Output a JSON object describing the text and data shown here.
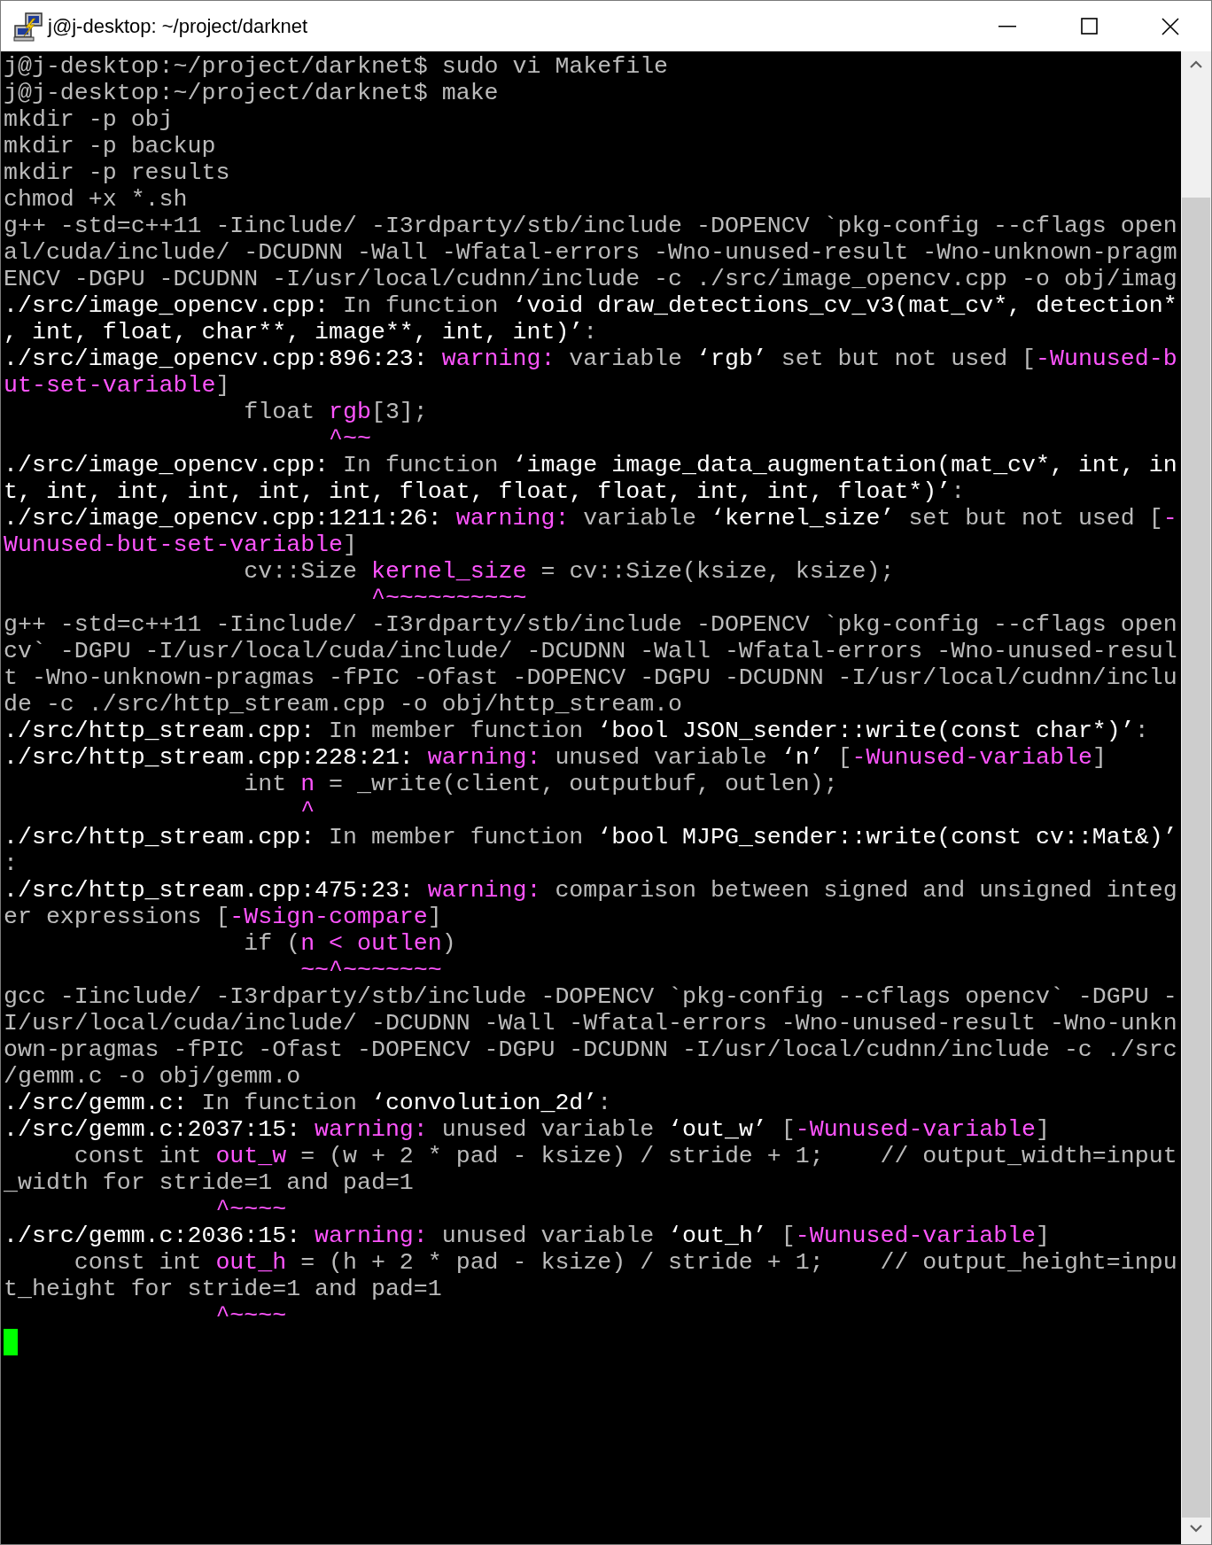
{
  "window": {
    "title": "j@j-desktop: ~/project/darknet"
  },
  "terminal": {
    "lines": [
      {
        "text": "j@j-desktop:~/project/darknet$ sudo vi Makefile"
      },
      {
        "text": "j@j-desktop:~/project/darknet$ make"
      },
      {
        "text": "mkdir -p obj"
      },
      {
        "text": "mkdir -p backup"
      },
      {
        "text": "mkdir -p results"
      },
      {
        "text": "chmod +x *.sh"
      },
      {
        "text": "g++ -std=c++11 -Iinclude/ -I3rdparty/stb/include -DOPENCV `pkg-config --cflags open"
      },
      {
        "text": "al/cuda/include/ -DCUDNN -Wall -Wfatal-errors -Wno-unused-result -Wno-unknown-pragm"
      },
      {
        "text": "ENCV -DGPU -DCUDNN -I/usr/local/cudnn/include -c ./src/image_opencv.cpp -o obj/imag"
      },
      {
        "spans": [
          {
            "text": "./src/image_opencv.cpp:",
            "kind": "bold"
          },
          {
            "text": " In function ",
            "kind": "normal"
          },
          {
            "text": "‘void draw_detections_cv_v3(mat_cv*, detection*",
            "kind": "bold"
          }
        ]
      },
      {
        "spans": [
          {
            "text": ", int, float, char**, image**, int, int)’",
            "kind": "bold"
          },
          {
            "text": ":",
            "kind": "normal"
          }
        ]
      },
      {
        "spans": [
          {
            "text": "./src/image_opencv.cpp:896:23: ",
            "kind": "bold"
          },
          {
            "text": "warning:",
            "kind": "accent"
          },
          {
            "text": " variable ",
            "kind": "normal"
          },
          {
            "text": "‘rgb’",
            "kind": "bold"
          },
          {
            "text": " set but not used [",
            "kind": "normal"
          },
          {
            "text": "-Wunused-b",
            "kind": "accent"
          }
        ]
      },
      {
        "spans": [
          {
            "text": "ut-set-variable",
            "kind": "accent"
          },
          {
            "text": "]",
            "kind": "normal"
          }
        ]
      },
      {
        "spans": [
          {
            "text": "                 float ",
            "kind": "normal"
          },
          {
            "text": "rgb",
            "kind": "accent"
          },
          {
            "text": "[3];",
            "kind": "normal"
          }
        ]
      },
      {
        "spans": [
          {
            "text": "                       ^~~",
            "kind": "accent"
          }
        ]
      },
      {
        "spans": [
          {
            "text": "./src/image_opencv.cpp:",
            "kind": "bold"
          },
          {
            "text": " In function ",
            "kind": "normal"
          },
          {
            "text": "‘image image_data_augmentation(mat_cv*, int, in",
            "kind": "bold"
          }
        ]
      },
      {
        "spans": [
          {
            "text": "t, int, int, int, int, int, float, float, float, int, int, float*)’",
            "kind": "bold"
          },
          {
            "text": ":",
            "kind": "normal"
          }
        ]
      },
      {
        "spans": [
          {
            "text": "./src/image_opencv.cpp:1211:26: ",
            "kind": "bold"
          },
          {
            "text": "warning:",
            "kind": "accent"
          },
          {
            "text": " variable ",
            "kind": "normal"
          },
          {
            "text": "‘kernel_size’",
            "kind": "bold"
          },
          {
            "text": " set but not used [",
            "kind": "normal"
          },
          {
            "text": "-",
            "kind": "accent"
          }
        ]
      },
      {
        "spans": [
          {
            "text": "Wunused-but-set-variable",
            "kind": "accent"
          },
          {
            "text": "]",
            "kind": "normal"
          }
        ]
      },
      {
        "spans": [
          {
            "text": "                 cv::Size ",
            "kind": "normal"
          },
          {
            "text": "kernel_size",
            "kind": "accent"
          },
          {
            "text": " = cv::Size(ksize, ksize);",
            "kind": "normal"
          }
        ]
      },
      {
        "spans": [
          {
            "text": "                          ^~~~~~~~~~~",
            "kind": "accent"
          }
        ]
      },
      {
        "text": "g++ -std=c++11 -Iinclude/ -I3rdparty/stb/include -DOPENCV `pkg-config --cflags open"
      },
      {
        "text": "cv` -DGPU -I/usr/local/cuda/include/ -DCUDNN -Wall -Wfatal-errors -Wno-unused-resul"
      },
      {
        "text": "t -Wno-unknown-pragmas -fPIC -Ofast -DOPENCV -DGPU -DCUDNN -I/usr/local/cudnn/inclu"
      },
      {
        "text": "de -c ./src/http_stream.cpp -o obj/http_stream.o"
      },
      {
        "spans": [
          {
            "text": "./src/http_stream.cpp:",
            "kind": "bold"
          },
          {
            "text": " In member function ",
            "kind": "normal"
          },
          {
            "text": "‘bool JSON_sender::write(const char*)’",
            "kind": "bold"
          },
          {
            "text": ":",
            "kind": "normal"
          }
        ]
      },
      {
        "spans": [
          {
            "text": "./src/http_stream.cpp:228:21: ",
            "kind": "bold"
          },
          {
            "text": "warning:",
            "kind": "accent"
          },
          {
            "text": " unused variable ",
            "kind": "normal"
          },
          {
            "text": "‘n’",
            "kind": "bold"
          },
          {
            "text": " [",
            "kind": "normal"
          },
          {
            "text": "-Wunused-variable",
            "kind": "accent"
          },
          {
            "text": "]",
            "kind": "normal"
          }
        ]
      },
      {
        "spans": [
          {
            "text": "                 int ",
            "kind": "normal"
          },
          {
            "text": "n",
            "kind": "accent"
          },
          {
            "text": " = _write(client, outputbuf, outlen);",
            "kind": "normal"
          }
        ]
      },
      {
        "spans": [
          {
            "text": "                     ^",
            "kind": "accent"
          }
        ]
      },
      {
        "spans": [
          {
            "text": "./src/http_stream.cpp:",
            "kind": "bold"
          },
          {
            "text": " In member function ",
            "kind": "normal"
          },
          {
            "text": "‘bool MJPG_sender::write(const cv::Mat&)’",
            "kind": "bold"
          }
        ]
      },
      {
        "text": ":"
      },
      {
        "spans": [
          {
            "text": "./src/http_stream.cpp:475:23: ",
            "kind": "bold"
          },
          {
            "text": "warning:",
            "kind": "accent"
          },
          {
            "text": " comparison between signed and unsigned integ",
            "kind": "normal"
          }
        ]
      },
      {
        "spans": [
          {
            "text": "er expressions [",
            "kind": "normal"
          },
          {
            "text": "-Wsign-compare",
            "kind": "accent"
          },
          {
            "text": "]",
            "kind": "normal"
          }
        ]
      },
      {
        "spans": [
          {
            "text": "                 if (",
            "kind": "normal"
          },
          {
            "text": "n < outlen",
            "kind": "accent"
          },
          {
            "text": ")",
            "kind": "normal"
          }
        ]
      },
      {
        "spans": [
          {
            "text": "                     ~~^~~~~~~~",
            "kind": "accent"
          }
        ]
      },
      {
        "text": "gcc -Iinclude/ -I3rdparty/stb/include -DOPENCV `pkg-config --cflags opencv` -DGPU -"
      },
      {
        "text": "I/usr/local/cuda/include/ -DCUDNN -Wall -Wfatal-errors -Wno-unused-result -Wno-unkn"
      },
      {
        "text": "own-pragmas -fPIC -Ofast -DOPENCV -DGPU -DCUDNN -I/usr/local/cudnn/include -c ./src"
      },
      {
        "text": "/gemm.c -o obj/gemm.o"
      },
      {
        "spans": [
          {
            "text": "./src/gemm.c:",
            "kind": "bold"
          },
          {
            "text": " In function ",
            "kind": "normal"
          },
          {
            "text": "‘convolution_2d’",
            "kind": "bold"
          },
          {
            "text": ":",
            "kind": "normal"
          }
        ]
      },
      {
        "spans": [
          {
            "text": "./src/gemm.c:2037:15: ",
            "kind": "bold"
          },
          {
            "text": "warning:",
            "kind": "accent"
          },
          {
            "text": " unused variable ",
            "kind": "normal"
          },
          {
            "text": "‘out_w’",
            "kind": "bold"
          },
          {
            "text": " [",
            "kind": "normal"
          },
          {
            "text": "-Wunused-variable",
            "kind": "accent"
          },
          {
            "text": "]",
            "kind": "normal"
          }
        ]
      },
      {
        "spans": [
          {
            "text": "     const int ",
            "kind": "normal"
          },
          {
            "text": "out_w",
            "kind": "accent"
          },
          {
            "text": " = (w + 2 * pad - ksize) / stride + 1;    // output_width=input",
            "kind": "normal"
          }
        ]
      },
      {
        "text": "_width for stride=1 and pad=1"
      },
      {
        "spans": [
          {
            "text": "               ^~~~~",
            "kind": "accent"
          }
        ]
      },
      {
        "spans": [
          {
            "text": "./src/gemm.c:2036:15: ",
            "kind": "bold"
          },
          {
            "text": "warning:",
            "kind": "accent"
          },
          {
            "text": " unused variable ",
            "kind": "normal"
          },
          {
            "text": "‘out_h’",
            "kind": "bold"
          },
          {
            "text": " [",
            "kind": "normal"
          },
          {
            "text": "-Wunused-variable",
            "kind": "accent"
          },
          {
            "text": "]",
            "kind": "normal"
          }
        ]
      },
      {
        "spans": [
          {
            "text": "     const int ",
            "kind": "normal"
          },
          {
            "text": "out_h",
            "kind": "accent"
          },
          {
            "text": " = (h + 2 * pad - ksize) / stride + 1;    // output_height=inpu",
            "kind": "normal"
          }
        ]
      },
      {
        "text": "t_height for stride=1 and pad=1"
      },
      {
        "spans": [
          {
            "text": "               ^~~~~",
            "kind": "accent"
          }
        ]
      }
    ],
    "cursor_visible": true
  }
}
